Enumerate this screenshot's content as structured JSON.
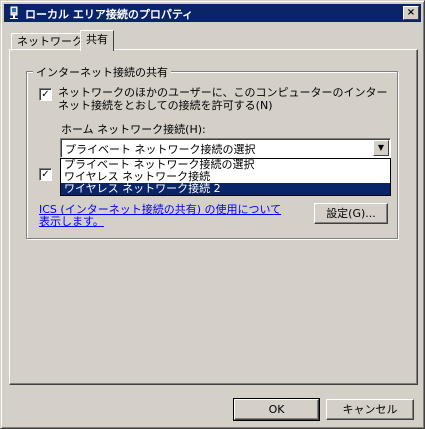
{
  "window": {
    "title": "ローカル エリア接続のプロパティ",
    "close_glyph": "×"
  },
  "tabs": [
    {
      "label": "ネットワーク",
      "active": false
    },
    {
      "label": "共有",
      "active": true
    }
  ],
  "ics_group": {
    "legend": "インターネット接続の共有",
    "allow_checkbox": {
      "checked": true,
      "label": "ネットワークのほかのユーザーに、このコンピューターのインターネット接続をとおしての接続を許可する(N)"
    },
    "second_checkbox": {
      "checked": true
    },
    "home_network_label": "ホーム ネットワーク接続(H):",
    "home_network_combo": {
      "value": "プライベート ネットワーク接続の選択",
      "options": [
        "プライベート ネットワーク接続の選択",
        "ワイヤレス ネットワーク接続",
        "ワイヤレス ネットワーク接続 2"
      ],
      "highlighted_index": 2
    },
    "ics_link": "ICS (インターネット接続の共有) の使用について表示します。",
    "settings_button": "設定(G)..."
  },
  "footer": {
    "ok": "OK",
    "cancel": "キャンセル"
  },
  "colors": {
    "titlebar": "#0a246a",
    "face": "#d4d0c8",
    "link": "#0000ff",
    "highlight": "#0a246a"
  },
  "icons": {
    "title": "network-connection-icon",
    "close": "close-icon",
    "dropdown": "chevron-down-icon",
    "check": "checkmark-icon"
  }
}
